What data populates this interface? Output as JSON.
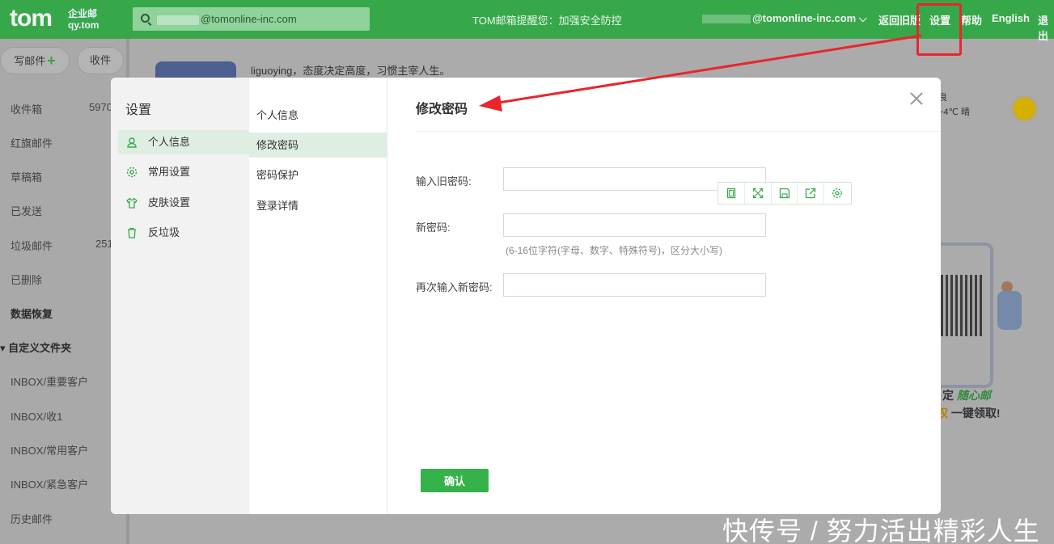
{
  "topbar": {
    "logo": "tom",
    "logo_sub1": "企业邮",
    "logo_sub2": "qy.tom",
    "search_value": "@tomonline-inc.com",
    "notice": "TOM邮箱提醒您：加强安全防控",
    "account": "@tomonline-inc.com ⌵",
    "nav": [
      "返回旧版",
      "设置",
      "帮助",
      "English",
      "退出"
    ]
  },
  "sidebar": {
    "compose": "写邮件",
    "receive": "收件",
    "items": [
      {
        "label": "收件箱",
        "count": "5970"
      },
      {
        "label": "红旗邮件",
        "count": ""
      },
      {
        "label": "草稿箱",
        "count": ""
      },
      {
        "label": "已发送",
        "count": ""
      },
      {
        "label": "垃圾邮件",
        "count": "251"
      },
      {
        "label": "已删除",
        "count": ""
      },
      {
        "label": "数据恢复",
        "count": ""
      },
      {
        "label": "▾ 自定义文件夹",
        "count": ""
      },
      {
        "label": "INBOX/重要客户",
        "count": ""
      },
      {
        "label": "INBOX/收1",
        "count": ""
      },
      {
        "label": "INBOX/常用客户",
        "count": ""
      },
      {
        "label": "INBOX/紧急客户",
        "count": ""
      },
      {
        "label": "历史邮件",
        "count": ""
      }
    ]
  },
  "background": {
    "motto": "liguoying，态度决定高度，习惯主宰人生。",
    "weather": "~4℃ 晴",
    "weather_top": "良",
    "promo1_a": "定 ",
    "promo1_b": "随心邮",
    "promo2_a": "权 ",
    "promo2_b": "一键领取!"
  },
  "dialog": {
    "title": "设置",
    "menu": [
      "个人信息",
      "常用设置",
      "皮肤设置",
      "反垃圾"
    ],
    "submenu": [
      "个人信息",
      "修改密码",
      "密码保护",
      "登录详情"
    ],
    "section_title": "修改密码",
    "fields": {
      "old_label": "输入旧密码:",
      "new_label": "新密码:",
      "hint": "(6-16位字符(字母、数字、特殊符号)，区分大小写)",
      "repeat_label": "再次输入新密码:"
    },
    "confirm": "确认"
  },
  "watermark": "快传号 / 努力活出精彩人生",
  "colors": {
    "brand_green": "#36a84a",
    "button_green": "#35b24a",
    "annotation_red": "#e8262b"
  }
}
